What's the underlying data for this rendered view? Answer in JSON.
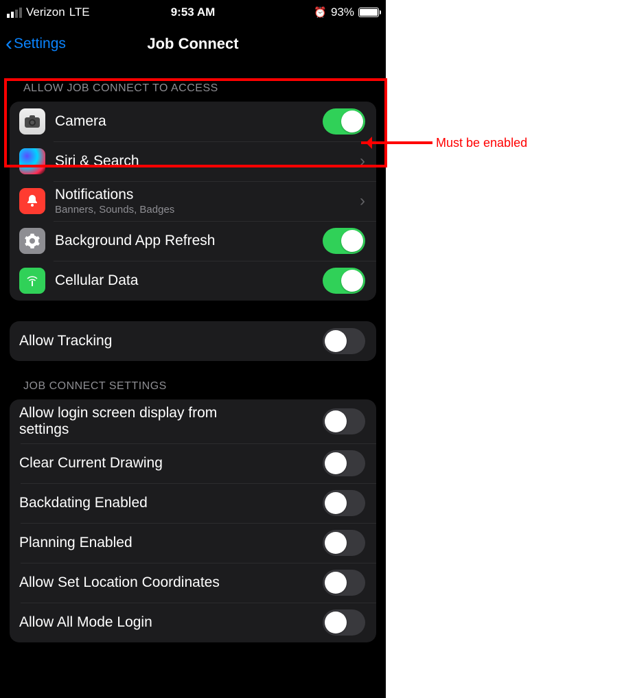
{
  "status": {
    "carrier": "Verizon",
    "network": "LTE",
    "time": "9:53 AM",
    "battery_pct": "93%",
    "signal_bars_active": 2
  },
  "nav": {
    "back_label": "Settings",
    "title": "Job Connect"
  },
  "sections": {
    "access_header": "ALLOW JOB CONNECT TO ACCESS",
    "access": {
      "camera": {
        "label": "Camera",
        "on": true
      },
      "siri": {
        "label": "Siri & Search"
      },
      "notif": {
        "label": "Notifications",
        "sub": "Banners, Sounds, Badges"
      },
      "bgr": {
        "label": "Background App Refresh",
        "on": true
      },
      "cell": {
        "label": "Cellular Data",
        "on": true
      }
    },
    "tracking": {
      "label": "Allow Tracking",
      "on": false
    },
    "app_header": "JOB CONNECT SETTINGS",
    "app": [
      {
        "label": "Allow login screen display from settings",
        "on": false
      },
      {
        "label": "Clear Current Drawing",
        "on": false
      },
      {
        "label": "Backdating Enabled",
        "on": false
      },
      {
        "label": "Planning Enabled",
        "on": false
      },
      {
        "label": "Allow Set Location Coordinates",
        "on": false
      },
      {
        "label": "Allow All Mode Login",
        "on": false
      }
    ]
  },
  "annotation": {
    "text": "Must be enabled"
  }
}
